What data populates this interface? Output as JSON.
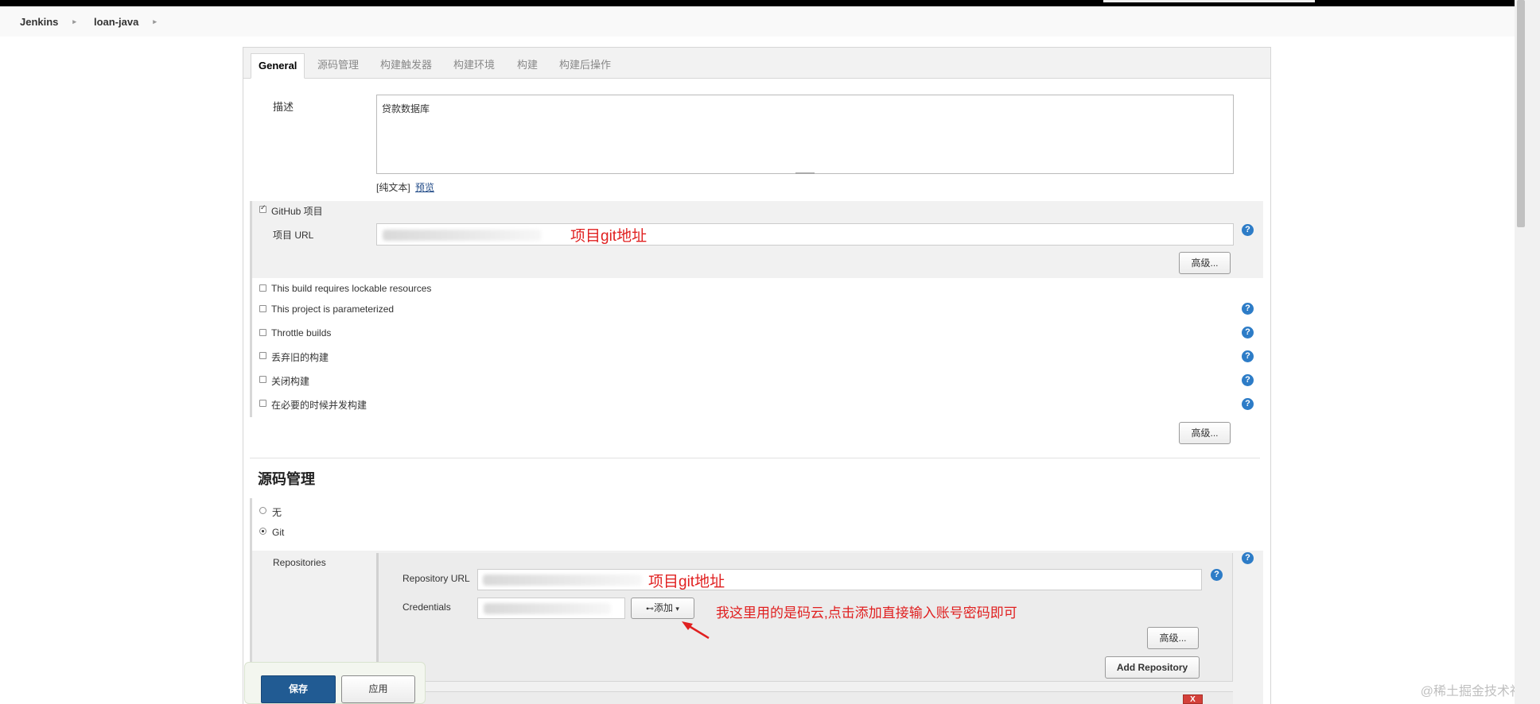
{
  "breadcrumb": {
    "items": [
      "Jenkins",
      "loan-java"
    ],
    "separator": "▸"
  },
  "tabs": [
    "General",
    "源码管理",
    "构建触发器",
    "构建环境",
    "构建",
    "构建后操作"
  ],
  "general": {
    "description_label": "描述",
    "description_value": "贷款数据库",
    "plain_text": "[纯文本]",
    "preview_link": "预览",
    "github_project_label": "GitHub 项目",
    "project_url_label": "项目 URL",
    "project_url_annotation": "项目git地址",
    "advanced_button": "高级...",
    "options": [
      "This build requires lockable resources",
      "This project is parameterized",
      "Throttle builds",
      "丢弃旧的构建",
      "关闭构建",
      "在必要的时候并发构建"
    ],
    "advanced_button_2": "高级..."
  },
  "scm": {
    "title": "源码管理",
    "option_none": "无",
    "option_git": "Git",
    "repositories_label": "Repositories",
    "repository_url_label": "Repository URL",
    "repository_url_annotation": "项目git地址",
    "credentials_label": "Credentials",
    "add_button": "添加",
    "credentials_annotation": "我这里用的是码云,点击添加直接输入账号密码即可",
    "advanced_button": "高级...",
    "add_repository_button": "Add Repository",
    "delete_button": "X"
  },
  "footer": {
    "save_button": "保存",
    "apply_button": "应用"
  },
  "watermark": "@稀土掘金技术社区",
  "icons": {
    "help": "help-icon",
    "key": "key-icon",
    "caret": "caret-down-icon"
  },
  "colors": {
    "help_blue": "#2d7cc7",
    "save_blue": "#215b93",
    "annotation_red": "#e02020"
  }
}
